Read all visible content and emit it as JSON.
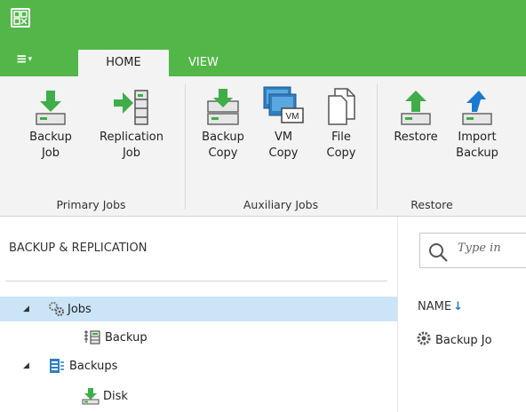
{
  "window": {
    "app_icon": "veeam-grid-icon",
    "accent_color": "#52b748"
  },
  "tabs": {
    "menu_label": "≡",
    "home": "HOME",
    "view": "VIEW"
  },
  "ribbon": {
    "primary_jobs": {
      "label": "Primary Jobs",
      "backup_job": [
        "Backup",
        "Job"
      ],
      "replication_job": [
        "Replication",
        "Job"
      ]
    },
    "auxiliary_jobs": {
      "label": "Auxiliary Jobs",
      "backup_copy": [
        "Backup",
        "Copy"
      ],
      "vm_copy": [
        "VM",
        "Copy"
      ],
      "vm_badge": "VM",
      "file_copy": [
        "File",
        "Copy"
      ]
    },
    "restore": {
      "label": "Restore",
      "restore": "Restore",
      "import_backup": [
        "Import",
        "Backup"
      ]
    }
  },
  "nav": {
    "title": "BACKUP & REPLICATION",
    "tree": {
      "jobs": "Jobs",
      "backup": "Backup",
      "backups": "Backups",
      "disk": "Disk"
    }
  },
  "main": {
    "search_placeholder": "Type in",
    "column_name": "NAME",
    "rows": [
      "Backup Jo"
    ]
  }
}
